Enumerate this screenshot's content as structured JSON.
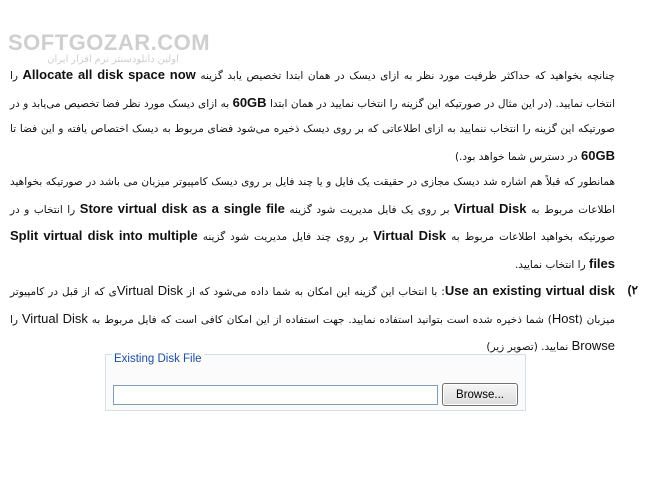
{
  "watermark": {
    "main": "SOFTGOZAR.COM",
    "sub": "اولین دانلودسنتر نرم افزار ایران"
  },
  "paragraphs": {
    "p1": {
      "t1": "چنانچه بخواهید که حداکثر ظرفیت مورد نظر به ازای دیسک در همان ابتدا تخصیص یابد گزینه ",
      "en1": "Allocate all disk space now",
      "t2": " را انتخاب نمایید. (در این مثال در صورتیکه این گزینه را انتخاب نمایید در همان ابتدا ",
      "en2": "60GB",
      "t3": " به ازای دیسک مورد نظر فضا تخصیص می‌یابد و در صورتیکه این گزینه را انتخاب ننمایید به ازای اطلاعاتی که بر روی دیسک ذخیره می‌شود فضای مربوط به دیسک اختصاص یافته و این فضا تا ",
      "en3": "60GB",
      "t4": " در دسترس شما خواهد بود.)"
    },
    "p2": {
      "t1": "همانطور که قبلاً هم اشاره شد دیسک مجازی در حقیقت یک فایل و یا چند فایل بر روی دیسک کامپیوتر میزبان می باشد در صورتیکه بخواهید اطلاعات مربوط به ",
      "en1": "Virtual Disk",
      "t2": " بر روی یک فایل مدیریت شود گزینه ",
      "en2": "Store virtual disk as a single file",
      "t3": " را انتخاب و در صورتیکه بخواهید اطلاعات مربوط به ",
      "en3": "Virtual Disk",
      "t4": " بر روی چند فایل مدیریت شود گزینه ",
      "en4": "Split virtual disk into multiple files",
      "t5": " را انتخاب نمایید."
    },
    "p3": {
      "number": "۲)",
      "en1": "Use an existing virtual disk",
      "t1": ": با انتخاب این گزینه این امکان به شما داده می‌شود که از ",
      "en2": "Virtual Disk",
      "t2": "ی که از قبل در کامپیوتر میزبان (",
      "en3": "Host",
      "t3": ") شما ذخیره شده است بتوانید استفاده نمایید. جهت استفاده از این امکان کافی است که فایل مربوط به ",
      "en4": "Virtual Disk",
      "t4": " را ",
      "en5": "Browse",
      "t5": " نمایید. (تصویر زیر)"
    }
  },
  "dialog": {
    "group_label": "Existing Disk File",
    "path_value": "",
    "browse_label": "Browse..."
  }
}
